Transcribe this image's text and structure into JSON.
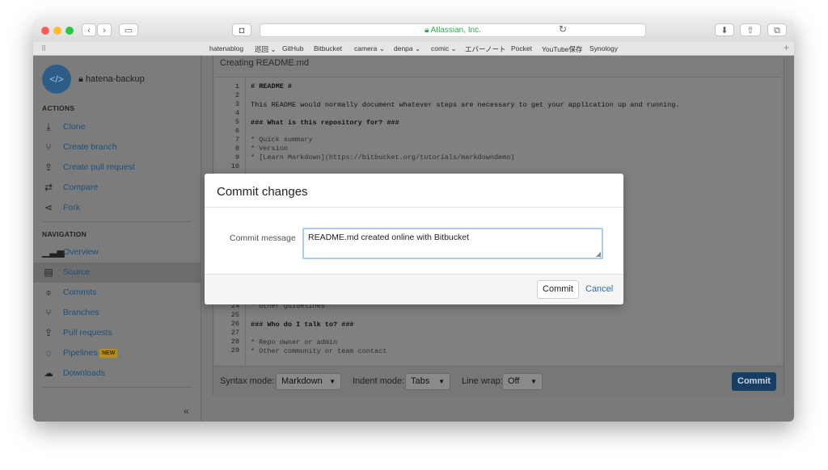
{
  "browser": {
    "url_title": "Atlassian, Inc.",
    "bookmarks": [
      "hatenablog",
      "巡回 ⌄",
      "GitHub",
      "Bitbucket",
      "camera ⌄",
      "denpa ⌄",
      "comic ⌄",
      "エバーノート",
      "Pocket",
      "YouTube保存",
      "Synology"
    ]
  },
  "sidebar": {
    "repo_name": "hatena-backup",
    "actions_title": "ACTIONS",
    "actions": [
      {
        "label": "Clone",
        "icon": "download-icon"
      },
      {
        "label": "Create branch",
        "icon": "branch-icon"
      },
      {
        "label": "Create pull request",
        "icon": "pull-request-icon"
      },
      {
        "label": "Compare",
        "icon": "compare-icon"
      },
      {
        "label": "Fork",
        "icon": "fork-icon"
      }
    ],
    "navigation_title": "NAVIGATION",
    "navigation": [
      {
        "label": "Overview",
        "icon": "chart-icon"
      },
      {
        "label": "Source",
        "icon": "file-icon"
      },
      {
        "label": "Commits",
        "icon": "commit-icon"
      },
      {
        "label": "Branches",
        "icon": "branch-icon"
      },
      {
        "label": "Pull requests",
        "icon": "pull-request-icon"
      },
      {
        "label": "Pipelines",
        "icon": "pipelines-icon",
        "badge": "NEW"
      },
      {
        "label": "Downloads",
        "icon": "cloud-download-icon"
      }
    ],
    "collapse_label": "«"
  },
  "editor": {
    "title": "Creating README.md",
    "lines": [
      {
        "n": "1",
        "text": "# README #"
      },
      {
        "n": "2",
        "text": ""
      },
      {
        "n": "3",
        "text": "This README would normally document whatever steps are necessary to get your application up and running."
      },
      {
        "n": "4",
        "text": ""
      },
      {
        "n": "5",
        "text": "### What is this repository for? ###"
      },
      {
        "n": "6",
        "text": ""
      },
      {
        "n": "7",
        "text": "* Quick summary"
      },
      {
        "n": "8",
        "text": "* Version"
      },
      {
        "n": "9",
        "text": "* [Learn Markdown](https://bitbucket.org/tutorials/markdowndemo)"
      },
      {
        "n": "10",
        "text": ""
      },
      {
        "n": "24",
        "text": "* Other guidelines"
      },
      {
        "n": "25",
        "text": ""
      },
      {
        "n": "26",
        "text": "### Who do I talk to? ###"
      },
      {
        "n": "27",
        "text": ""
      },
      {
        "n": "28",
        "text": "* Repo owner or admin"
      },
      {
        "n": "29",
        "text": "* Other community or team contact"
      }
    ],
    "syntax_label": "Syntax mode:",
    "syntax_value": "Markdown",
    "indent_label": "Indent mode:",
    "indent_value": "Tabs",
    "wrap_label": "Line wrap:",
    "wrap_value": "Off",
    "commit_label": "Commit"
  },
  "modal": {
    "title": "Commit changes",
    "message_label": "Commit message",
    "message_value": "README.md created online with Bitbucket",
    "commit_label": "Commit",
    "cancel_label": "Cancel"
  },
  "colors": {
    "accent": "#173f66",
    "link": "#2e6dab",
    "secure": "#2ea84b"
  }
}
